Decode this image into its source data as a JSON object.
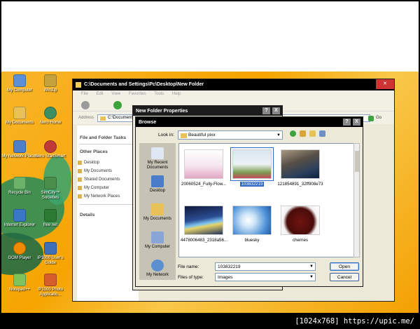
{
  "desktop": {
    "icons": [
      {
        "label": "My Computer",
        "color": "#5b8fd6"
      },
      {
        "label": "My Documents",
        "color": "#e8c257"
      },
      {
        "label": "My Network Places",
        "color": "#4e7fc9"
      },
      {
        "label": "Recycle Bin",
        "color": "#6bb36a"
      },
      {
        "label": "Internet Explorer",
        "color": "#3b77c7"
      },
      {
        "label": "GOM Player",
        "color": "#f08a00"
      },
      {
        "label": "Notepad++",
        "color": "#7ec45b"
      },
      {
        "label": "WinZip",
        "color": "#c4a23c"
      },
      {
        "label": "Nero Home",
        "color": "#3c8f63"
      },
      {
        "label": "Nero StartSmart",
        "color": "#c03a3a"
      },
      {
        "label": "SimCity™ Societies",
        "color": "#4b8e4b"
      },
      {
        "label": "free net",
        "color": "#2d7a33"
      },
      {
        "label": "iP1000 User's Guide",
        "color": "#3f6fb5"
      },
      {
        "label": "iP1000 Photo Applicatio...",
        "color": "#d65d2c"
      }
    ]
  },
  "explorer": {
    "title": "C:\\Documents and Settings\\Pc\\Desktop\\New Folder",
    "menu": [
      "File",
      "Edit",
      "View",
      "Favorites",
      "Tools",
      "Help"
    ],
    "address_label": "Address",
    "address_value": "C:\\Documents",
    "go_label": "Go",
    "tasks_title": "File and Folder Tasks",
    "other_places_title": "Other Places",
    "other_places": [
      "Desktop",
      "My Documents",
      "Shared Documents",
      "My Computer",
      "My Network Places"
    ],
    "details_title": "Details"
  },
  "properties": {
    "title": "New Folder Properties",
    "help_btn": "?",
    "close_btn": "X"
  },
  "browse": {
    "title": "Browse",
    "help_btn": "?",
    "close_btn": "X",
    "look_in_label": "Look in:",
    "look_in_value": "Beautiful pixx",
    "places": [
      "My Recent Documents",
      "Desktop",
      "My Documents",
      "My Computer",
      "My Network"
    ],
    "files": [
      {
        "name": "20060524_Fully-Flow...",
        "selected": false
      },
      {
        "name": "103832219",
        "selected": true
      },
      {
        "name": "121854891_32ff908e73",
        "selected": false
      },
      {
        "name": "4478006483_2318a56...",
        "selected": false
      },
      {
        "name": "bluesky",
        "selected": false
      },
      {
        "name": "cherries",
        "selected": false
      }
    ],
    "file_name_label": "File name:",
    "file_name_value": "103832219",
    "file_type_label": "Files of type:",
    "file_type_value": "Images",
    "open_label": "Open",
    "cancel_label": "Cancel"
  },
  "watermark": "[1024x768] https://upic.me/"
}
